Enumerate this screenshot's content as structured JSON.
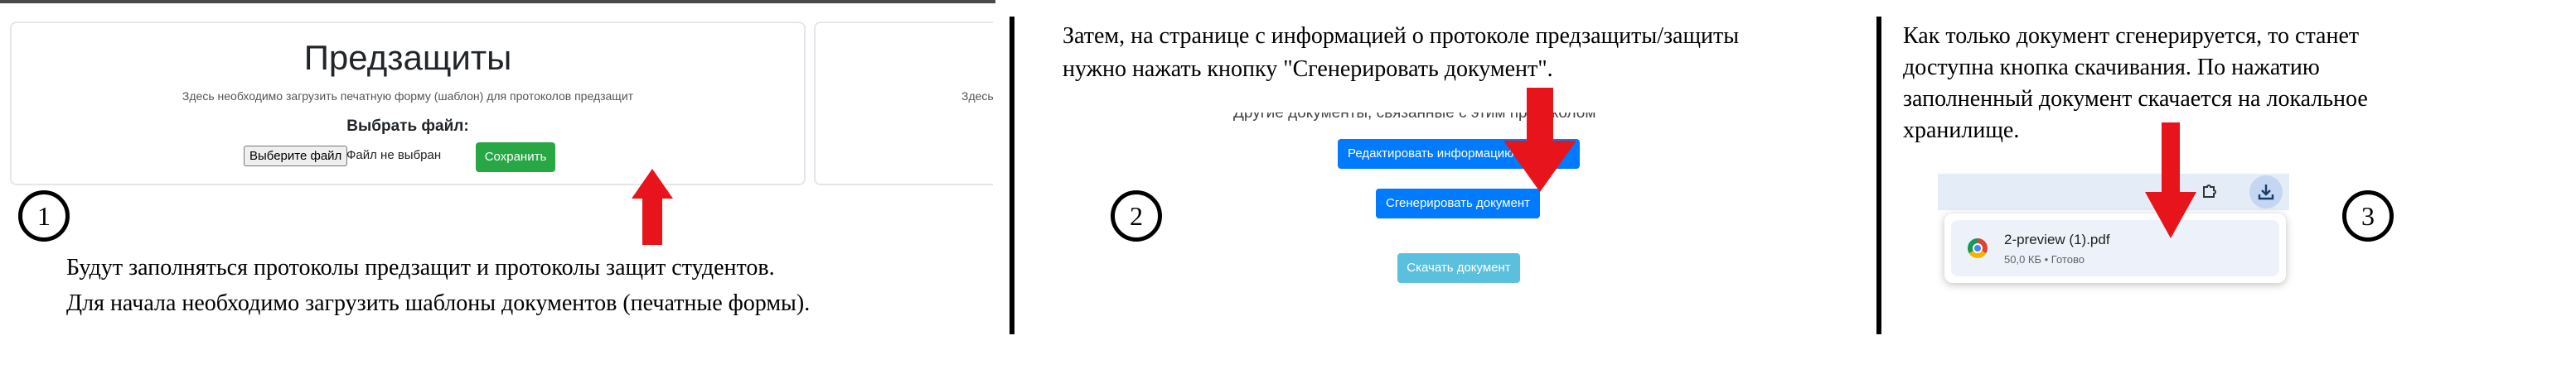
{
  "panel1": {
    "card_title": "Предзащиты",
    "card_subtitle": "Здесь необходимо загрузить печатную форму (шаблон) для протоколов предзащит",
    "choose_file_label": "Выбрать файл:",
    "file_button_label": "Выберите файл",
    "file_status": "Файл не выбран",
    "save_button_label": "Сохранить",
    "peek_text": "Здесь",
    "step_number": "1",
    "caption_lines": [
      "Будут заполняться протоколы предзащит и протоколы защит студентов.",
      "Для начала необходимо загрузить шаблоны документов (печатные формы)."
    ]
  },
  "panel2": {
    "caption_lines": [
      "Затем, на странице с информацией о протоколе предзащиты/защиты",
      "нужно нажать кнопку \"Сгенерировать документ\"."
    ],
    "partial_text": "Другие документы, связанные с этим протоколом",
    "edit_button_label": "Редактировать информацию",
    "generate_button_label": "Сгенерировать документ",
    "download_button_label": "Скачать документ",
    "step_number": "2"
  },
  "panel3": {
    "caption_lines": [
      "Как только документ сгенерируется, то станет",
      "доступна кнопка скачивания. По нажатию",
      "заполненный документ скачается на локальное",
      "хранилище."
    ],
    "file_name": "2-preview (1).pdf",
    "file_meta": "50,0 КБ • Готово",
    "step_number": "3"
  },
  "colors": {
    "arrow": "#e8141c",
    "save_green": "#28a745",
    "primary_blue": "#007bff",
    "download_teal": "#5bc0de",
    "chrome_blue": "#1a73e8"
  }
}
